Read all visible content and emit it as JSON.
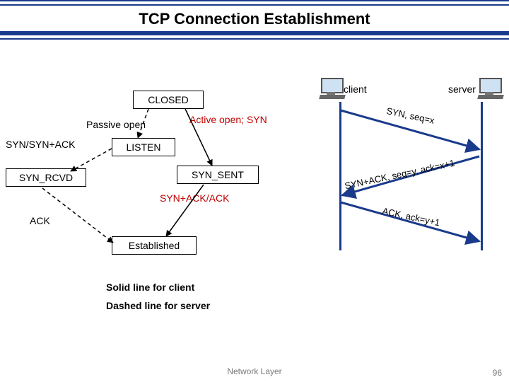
{
  "header": {
    "title": "TCP Connection Establishment"
  },
  "states": {
    "closed": "CLOSED",
    "passive_open": "Passive open",
    "listen": "LISTEN",
    "syn_rcvd": "SYN_RCVD",
    "syn_sent": "SYN_SENT",
    "established": "Established",
    "active_open": "Active open;  SYN",
    "syn_synack": "SYN/SYN+ACK",
    "synack_ack": "SYN+ACK/ACK",
    "ack": "ACK"
  },
  "legend": {
    "client_line": "Solid line for client",
    "server_line": "Dashed line for server"
  },
  "seq": {
    "client_label": "client",
    "server_label": "server",
    "msg1": "SYN, seq=x",
    "msg2": "SYN+ACK, seq=y, ack=x+1",
    "msg3": "ACK, ack=y+1"
  },
  "footer": {
    "text": "Network Layer",
    "slide_no": "96"
  }
}
